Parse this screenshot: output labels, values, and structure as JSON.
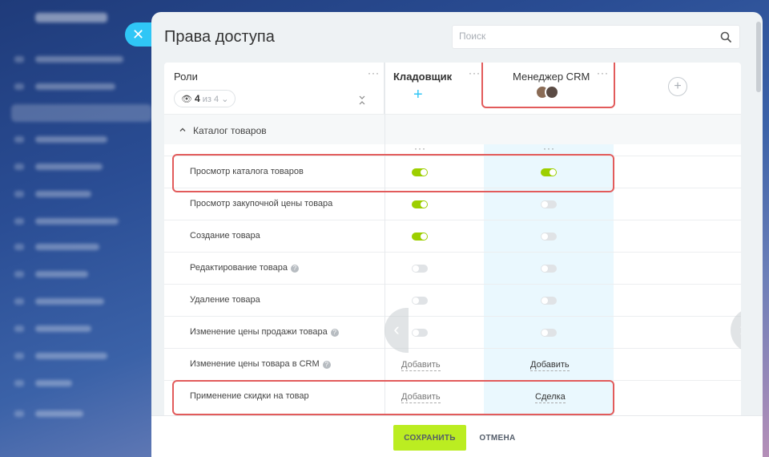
{
  "panel": {
    "title": "Права доступа"
  },
  "search": {
    "placeholder": "Поиск"
  },
  "roles": {
    "title": "Роли",
    "count": "4",
    "of_text": "из 4"
  },
  "columns": [
    {
      "title": "Кладовщик"
    },
    {
      "title": "Менеджер CRM"
    }
  ],
  "section": {
    "title": "Каталог товаров"
  },
  "rows": [
    {
      "label": "Просмотр каталога товаров",
      "storekeeper": true,
      "crm": true
    },
    {
      "label": "Просмотр закупочной цены товара",
      "storekeeper": true,
      "crm": false
    },
    {
      "label": "Создание товара",
      "storekeeper": true,
      "crm": false
    },
    {
      "label": "Редактирование товара",
      "storekeeper": false,
      "crm": false
    },
    {
      "label": "Удаление товара",
      "storekeeper": false,
      "crm": false
    },
    {
      "label": "Изменение цены продажи товара",
      "storekeeper": false,
      "crm": false
    },
    {
      "label": "Изменение цены товара в CRM",
      "storekeeper_text": "Добавить",
      "crm_text": "Добавить"
    },
    {
      "label": "Применение скидки на товар",
      "storekeeper_text": "Добавить",
      "crm_text": "Сделка"
    }
  ],
  "footer": {
    "save_label": "СОХРАНИТЬ",
    "cancel_label": "ОТМЕНА"
  },
  "colors": {
    "accent": "#2fc6f6",
    "toggle_on": "#9dcf00",
    "save_button": "#bbed21",
    "highlight": "#e25b5b"
  }
}
